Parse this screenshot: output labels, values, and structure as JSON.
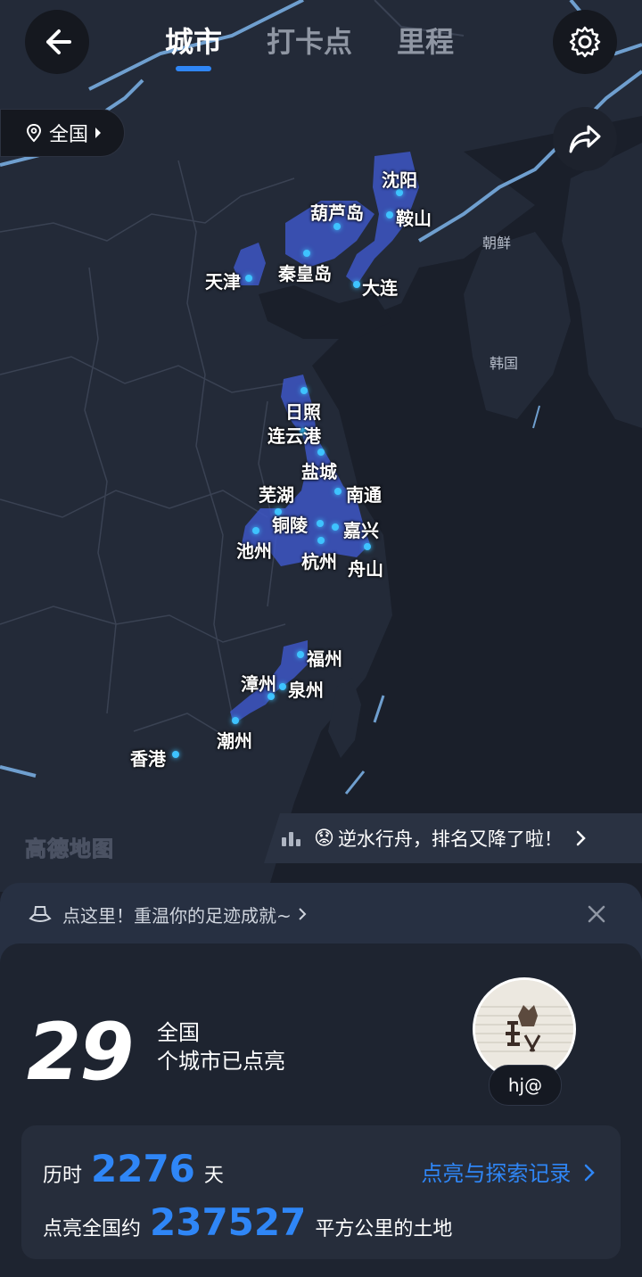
{
  "header": {
    "tabs": [
      {
        "label": "城市",
        "active": true
      },
      {
        "label": "打卡点",
        "active": false
      },
      {
        "label": "里程",
        "active": false
      }
    ]
  },
  "region_selector": {
    "label": "全国"
  },
  "map": {
    "brand": "高德地图",
    "countries": [
      "朝鲜",
      "韩国"
    ],
    "cities": [
      "沈阳",
      "葫芦岛",
      "鞍山",
      "天津",
      "秦皇岛",
      "大连",
      "日照",
      "连云港",
      "盐城",
      "芜湖",
      "南通",
      "铜陵",
      "嘉兴",
      "池州",
      "杭州",
      "舟山",
      "福州",
      "漳州",
      "泉州",
      "潮州",
      "香港"
    ],
    "rank_banner": {
      "emoji": "😟",
      "text": "逆水行舟，排名又降了啦！"
    }
  },
  "sheet": {
    "hint": "点这里！重温你的足迹成就~",
    "city_count": "29",
    "scope": "全国",
    "lit_label": "个城市已点亮",
    "username": "hj@",
    "stats": {
      "duration_prefix": "历时",
      "days": "2276",
      "days_unit": "天",
      "area_prefix": "点亮全国约",
      "area": "237527",
      "area_unit": "平方公里的土地",
      "records_link": "点亮与探索记录"
    }
  },
  "colors": {
    "accent": "#2f86f6",
    "dot": "#3ec3ff",
    "lit_region": "#3d56c4"
  }
}
